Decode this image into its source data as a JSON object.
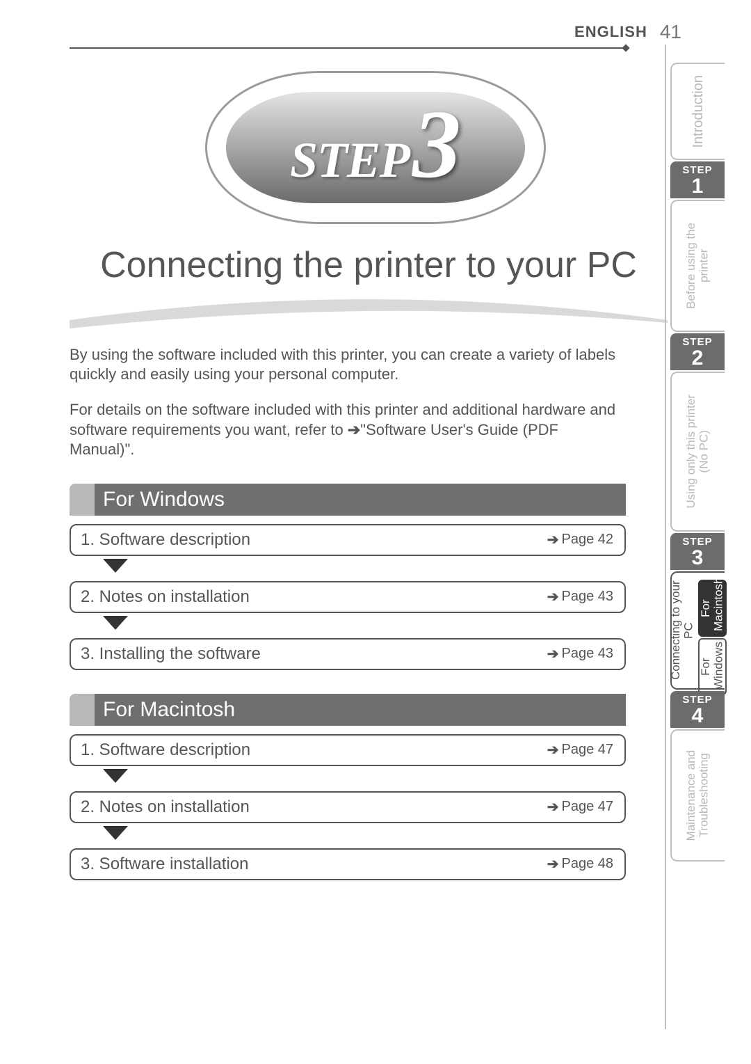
{
  "header": {
    "language": "ENGLISH",
    "page_number": "41"
  },
  "badge": {
    "step_word": "STEP",
    "step_number": "3"
  },
  "title": "Connecting the printer to your PC",
  "intro": {
    "p1": "By using the software included with this printer, you can create a variety of labels quickly and easily using your personal computer.",
    "p2a": "For details on the software included with this printer and additional hardware and software requirements you want, refer to ",
    "p2_arrow": "➔",
    "p2b": "\"Software User's Guide (PDF Manual)\"."
  },
  "sections": {
    "windows": {
      "heading": "For Windows",
      "items": [
        {
          "label": "1. Software description",
          "page": "Page 42"
        },
        {
          "label": "2. Notes on installation",
          "page": "Page 43"
        },
        {
          "label": "3. Installing the software",
          "page": "Page 43"
        }
      ]
    },
    "mac": {
      "heading": "For Macintosh",
      "items": [
        {
          "label": "1. Software description",
          "page": "Page 47"
        },
        {
          "label": "2. Notes on installation",
          "page": "Page 47"
        },
        {
          "label": "3. Software installation",
          "page": "Page 48"
        }
      ]
    }
  },
  "sidebar": {
    "intro": "Introduction",
    "step_label": "STEP",
    "step1": {
      "num": "1",
      "text1": "Before using the",
      "text2": "printer"
    },
    "step2": {
      "num": "2",
      "text1": "Using only this printer",
      "text2": "(No PC)"
    },
    "step3": {
      "num": "3",
      "text": "Connecting to your PC",
      "micro_mac": "For Macintosh",
      "micro_win": "For Windows"
    },
    "step4": {
      "num": "4",
      "text1": "Maintenance and",
      "text2": "Troubleshooting"
    }
  }
}
